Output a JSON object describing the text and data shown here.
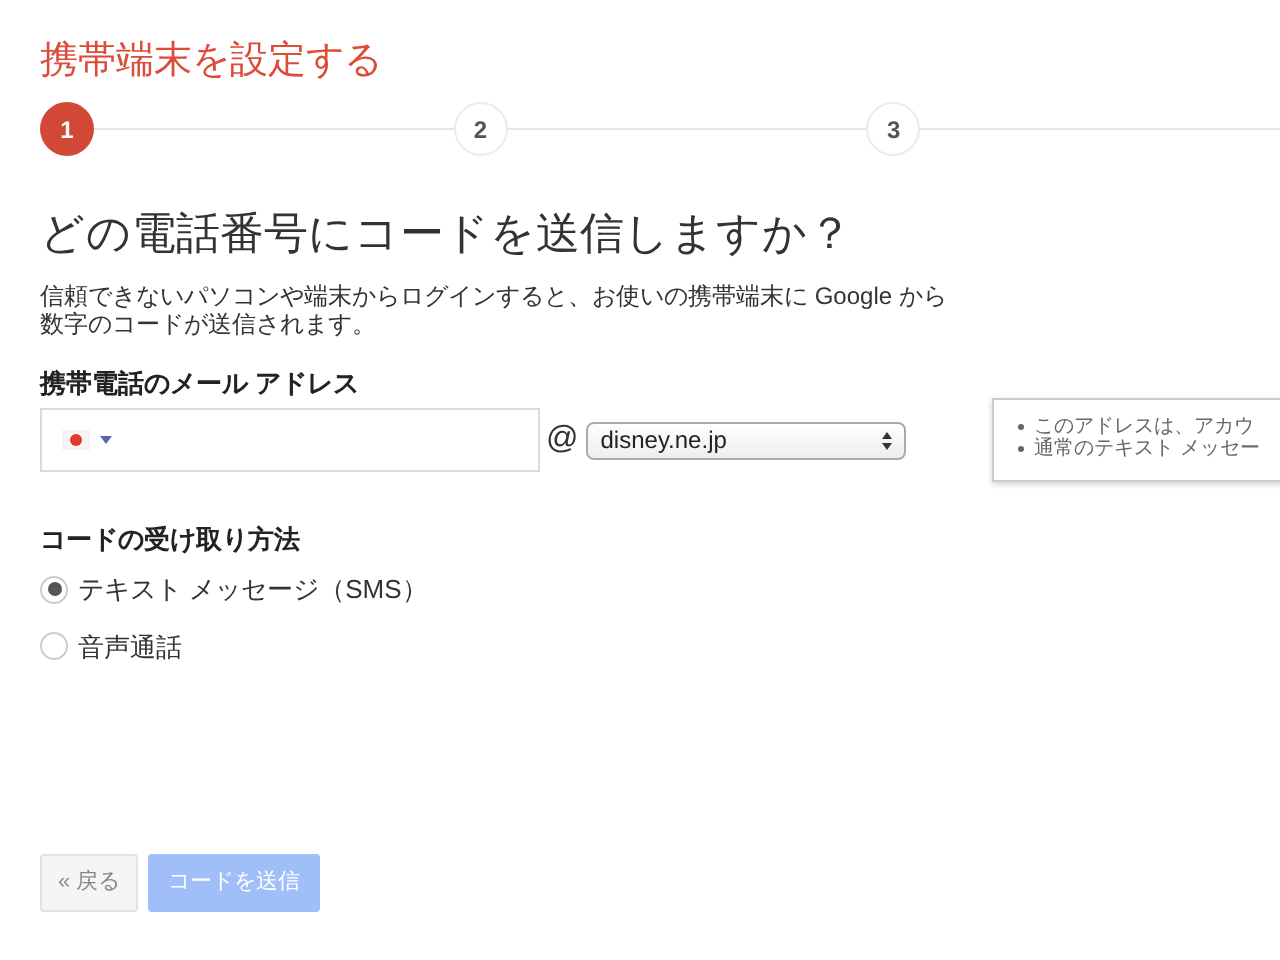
{
  "title": "携帯端末を設定する",
  "steps": [
    {
      "label": "1",
      "selected": true
    },
    {
      "label": "2",
      "selected": false
    },
    {
      "label": "3",
      "selected": false
    }
  ],
  "heading": "どの電話番号にコードを送信しますか？",
  "description": "信頼できないパソコンや端末からログインすると、お使いの携帯端末に Google から数字のコードが送信されます。",
  "email_label": "携帯電話のメール アドレス",
  "at_sign": "@",
  "domain_select": {
    "value": "disney.ne.jp"
  },
  "tooltip": {
    "items": [
      "このアドレスは、アカウ",
      "通常のテキスト メッセー"
    ]
  },
  "method_label": "コードの受け取り方法",
  "methods": [
    {
      "label": "テキスト メッセージ（SMS）",
      "selected": true
    },
    {
      "label": "音声通話",
      "selected": false
    }
  ],
  "buttons": [
    {
      "label": "« 戻る",
      "kind": "back"
    },
    {
      "label": "コードを送信",
      "kind": "primary",
      "disabled": true
    }
  ]
}
